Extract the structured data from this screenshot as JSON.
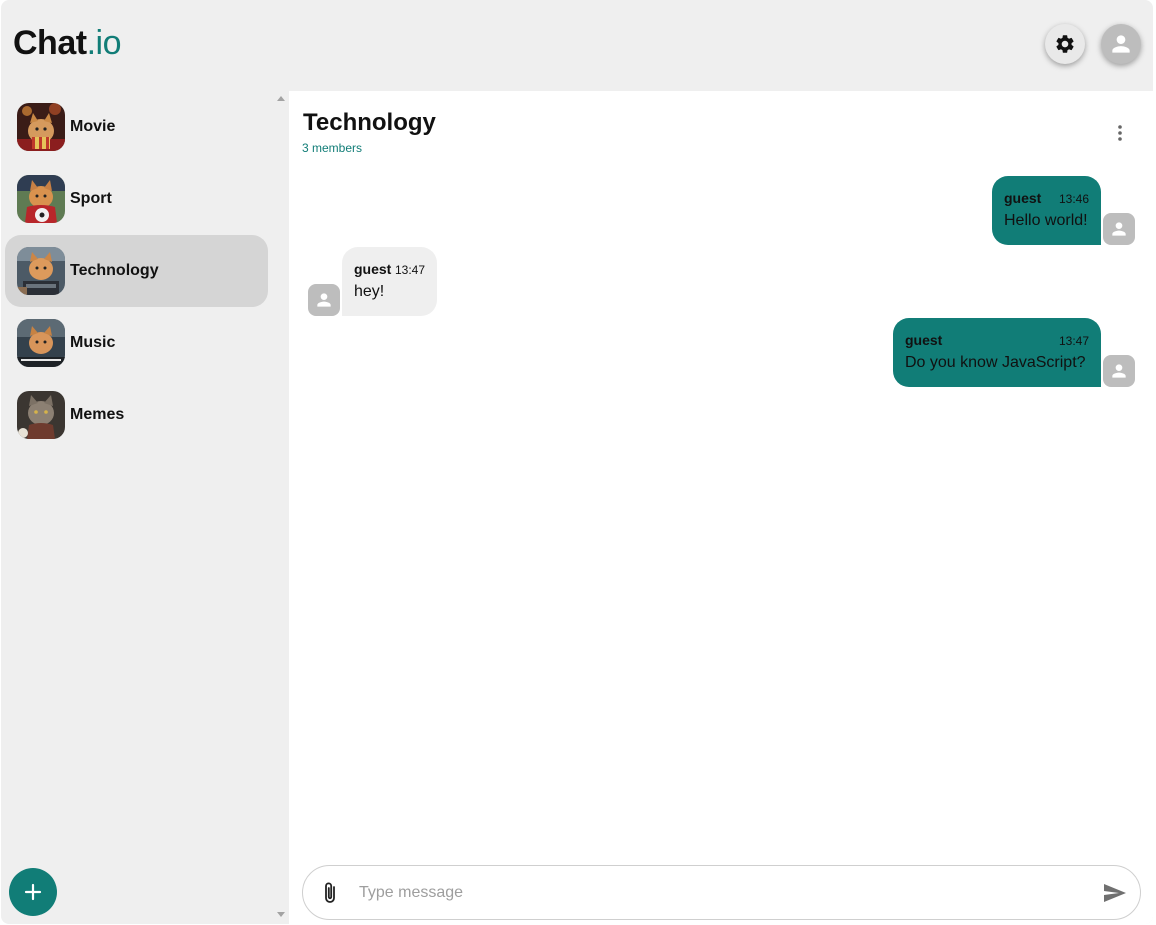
{
  "app": {
    "logo_main": "Chat",
    "logo_accent": ".io"
  },
  "header": {
    "settings_icon": "gear-icon",
    "profile_icon": "person-icon"
  },
  "sidebar": {
    "rooms": [
      {
        "label": "Movie",
        "active": false
      },
      {
        "label": "Sport",
        "active": false
      },
      {
        "label": "Technology",
        "active": true
      },
      {
        "label": "Music",
        "active": false
      },
      {
        "label": "Memes",
        "active": false
      }
    ],
    "add_icon": "plus-icon"
  },
  "chat": {
    "title": "Technology",
    "members": "3 members",
    "messages": [
      {
        "author": "guest",
        "time": "13:46",
        "text": "Hello world!",
        "mine": true
      },
      {
        "author": "guest",
        "time": "13:47",
        "text": "hey!",
        "mine": false
      },
      {
        "author": "guest",
        "time": "13:47",
        "text": "Do you know JavaScript?",
        "mine": true
      }
    ]
  },
  "composer": {
    "placeholder": "Type message",
    "value": ""
  },
  "colors": {
    "accent": "#117d77",
    "sidebar_bg": "#efefef",
    "active_room": "#d5d5d5",
    "avatar_gray": "#bdbdbd"
  }
}
